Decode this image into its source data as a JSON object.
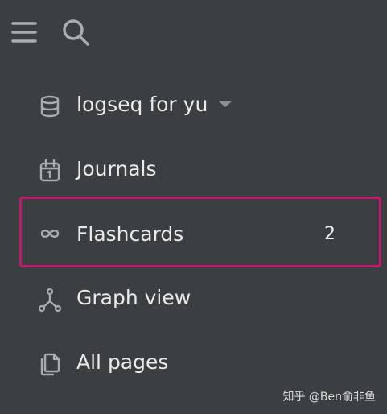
{
  "header": {
    "menu_icon": "hamburger-menu-icon",
    "search_icon": "search-icon"
  },
  "sidebar": {
    "items": [
      {
        "label": "logseq for yu",
        "icon": "database-icon",
        "has_dropdown": true,
        "active": false
      },
      {
        "label": "Journals",
        "icon": "calendar-icon",
        "active": false
      },
      {
        "label": "Flashcards",
        "icon": "infinity-icon",
        "count": "2",
        "active": true
      },
      {
        "label": "Graph view",
        "icon": "graph-icon",
        "active": false
      },
      {
        "label": "All pages",
        "icon": "pages-icon",
        "active": false
      }
    ]
  },
  "watermark": "知乎 @Ben俞非鱼",
  "colors": {
    "background": "#3b3f42",
    "text": "#e8eaec",
    "icon": "#a9adb2",
    "highlight_border": "#c0186c"
  }
}
